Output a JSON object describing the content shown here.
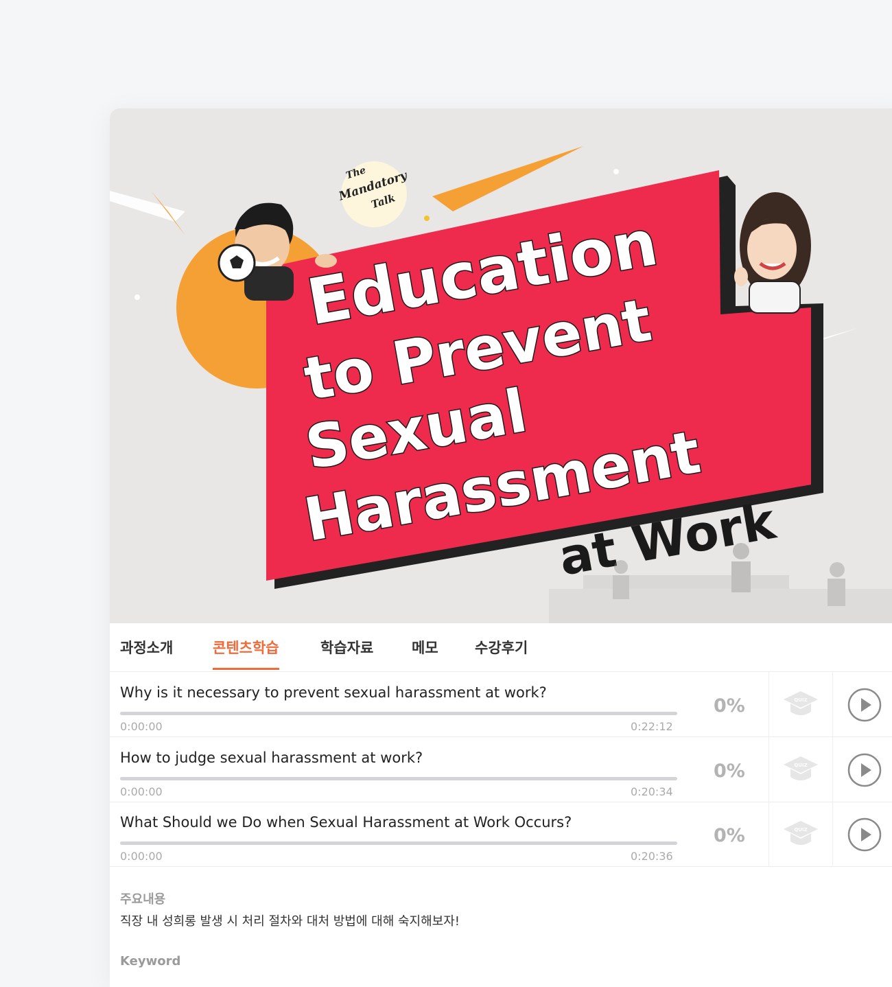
{
  "banner": {
    "badge": [
      "The",
      "Mandatory",
      "Talk"
    ],
    "title_lines": [
      "Education",
      "to Prevent",
      "Sexual",
      "Harassment"
    ],
    "title_tail": "at Work",
    "colors": {
      "red": "#ee2a4d",
      "orange": "#f5a035",
      "background": "#e9e7e5"
    }
  },
  "tabs": [
    {
      "label": "과정소개",
      "active": false
    },
    {
      "label": "콘텐츠학습",
      "active": true
    },
    {
      "label": "학습자료",
      "active": false
    },
    {
      "label": "메모",
      "active": false
    },
    {
      "label": "수강후기",
      "active": false
    }
  ],
  "lessons": [
    {
      "title": "Why is it necessary to prevent sexual harassment at work?",
      "start": "0:00:00",
      "end": "0:22:12",
      "progress": "0%",
      "progress_fraction": 0,
      "quiz_icon": "quiz-cap-icon",
      "play_icon": "play-circle-icon"
    },
    {
      "title": "How to judge sexual harassment at work?",
      "start": "0:00:00",
      "end": "0:20:34",
      "progress": "0%",
      "progress_fraction": 0,
      "quiz_icon": "quiz-cap-icon",
      "play_icon": "play-circle-icon"
    },
    {
      "title": "What Should we Do when Sexual Harassment at Work Occurs?",
      "start": "0:00:00",
      "end": "0:20:36",
      "progress": "0%",
      "progress_fraction": 0,
      "quiz_icon": "quiz-cap-icon",
      "play_icon": "play-circle-icon"
    }
  ],
  "summary": {
    "label": "주요내용",
    "text": "직장 내 성희롱 발생 시 처리 절차와 대처 방법에 대해 숙지해보자!"
  },
  "keywords": {
    "label": "Keyword"
  },
  "accent_color": "#f06a3a"
}
